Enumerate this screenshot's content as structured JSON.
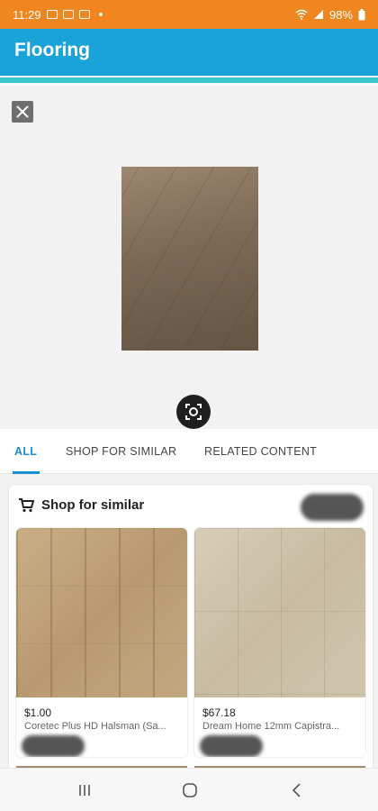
{
  "status_bar": {
    "time": "11:29",
    "battery": "98%"
  },
  "app_bar": {
    "title": "Flooring"
  },
  "tabs": [
    {
      "label": "ALL",
      "active": true
    },
    {
      "label": "SHOP FOR SIMILAR",
      "active": false
    },
    {
      "label": "RELATED CONTENT",
      "active": false
    }
  ],
  "shop_panel": {
    "title": "Shop for similar",
    "products": [
      {
        "price": "$1.00",
        "name": "Coretec Plus HD Halsman (Sa..."
      },
      {
        "price": "$67.18",
        "name": "Dream Home 12mm Capistra..."
      }
    ]
  },
  "colors": {
    "status_bar": "#f0861f",
    "app_bar": "#1aa3d9",
    "accent_rule": "#39c7cc",
    "tab_active": "#1a8fd0"
  }
}
